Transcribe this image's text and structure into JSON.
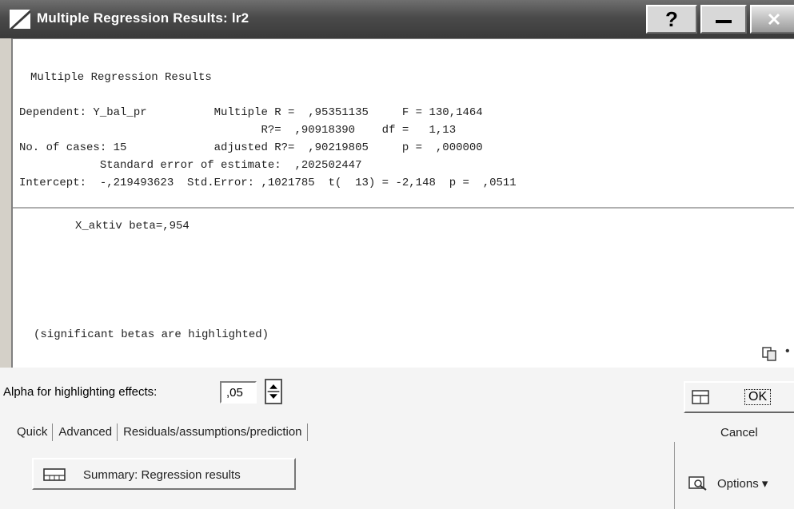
{
  "window": {
    "title": "Multiple Regression Results: lr2"
  },
  "output": {
    "header": "Multiple Regression Results",
    "lines": [
      "Dependent: Y_bal_pr          Multiple R =  ,95351135     F = 130,1464",
      "                                    R?=  ,90918390    df =   1,13",
      "No. of cases: 15             adjusted R?=  ,90219805     p =  ,000000",
      "            Standard error of estimate:  ,202502447",
      "Intercept:  -,219493623  Std.Error: ,1021785  t(  13) = -2,148  p =  ,0511"
    ],
    "beta_line": "X_aktiv beta=,954",
    "footnote": "(significant betas are highlighted)"
  },
  "controls": {
    "alpha_label": "Alpha for highlighting effects:",
    "alpha_value": ",05",
    "tabs": [
      "Quick",
      "Advanced",
      "Residuals/assumptions/prediction"
    ],
    "summary_button": "Summary:  Regression results",
    "ok": "OK",
    "cancel": "Cancel",
    "options": "Options ▾"
  }
}
